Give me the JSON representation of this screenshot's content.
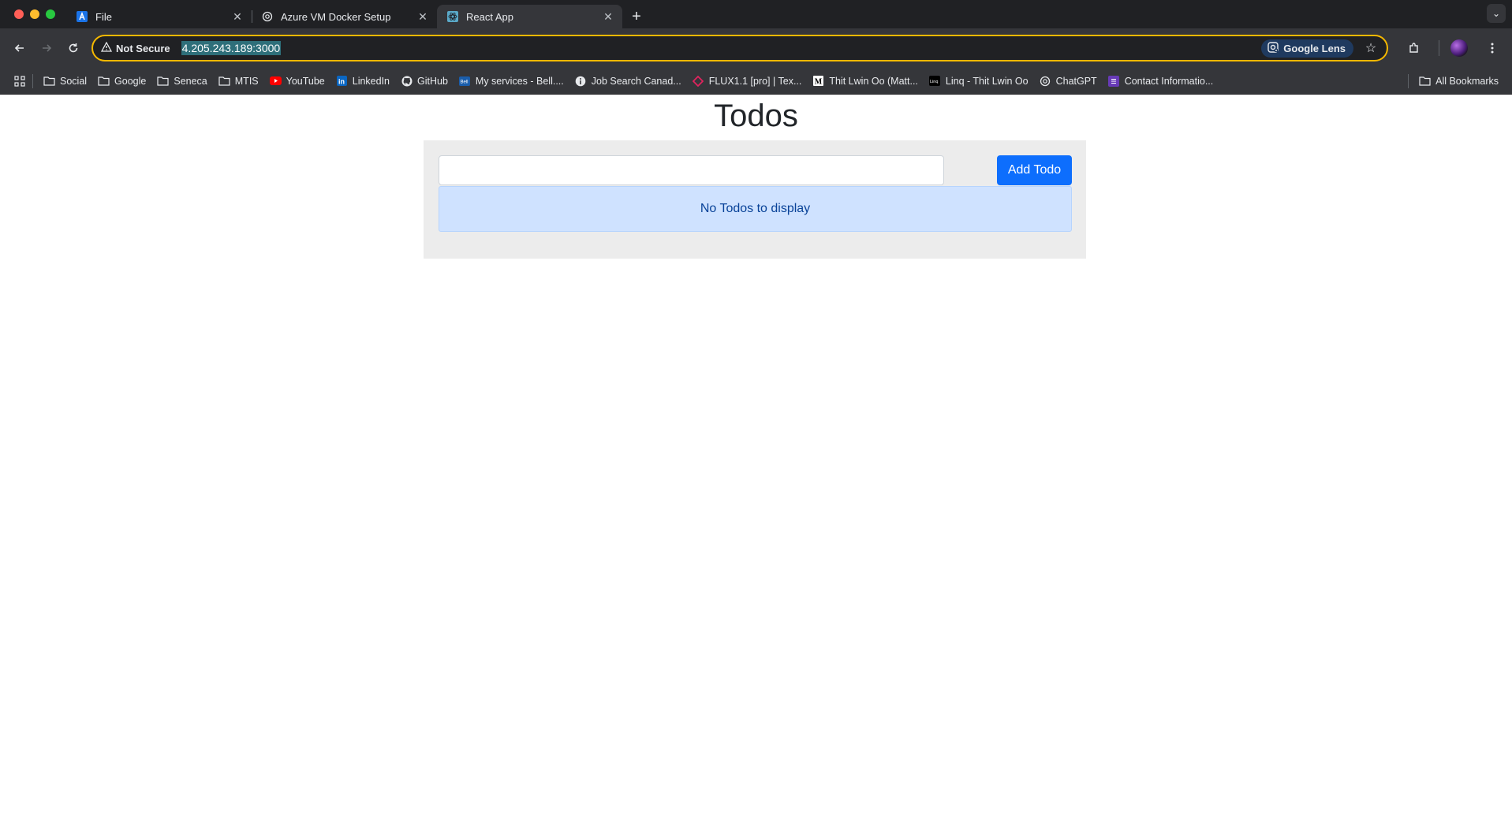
{
  "tabs": [
    {
      "title": "File",
      "icon": "azure-devops-icon",
      "active": false
    },
    {
      "title": "Azure VM Docker Setup",
      "icon": "chatgpt-icon",
      "active": false
    },
    {
      "title": "React App",
      "icon": "react-icon",
      "active": true
    }
  ],
  "toolbar": {
    "security_label": "Not Secure",
    "url": "4.205.243.189:3000",
    "lens_label": "Google Lens"
  },
  "bookmarks": {
    "items": [
      {
        "label": "Social",
        "icon": "folder-icon"
      },
      {
        "label": "Google",
        "icon": "folder-icon"
      },
      {
        "label": "Seneca",
        "icon": "folder-icon"
      },
      {
        "label": "MTIS",
        "icon": "folder-icon"
      },
      {
        "label": "YouTube",
        "icon": "youtube-icon"
      },
      {
        "label": "LinkedIn",
        "icon": "linkedin-icon"
      },
      {
        "label": "GitHub",
        "icon": "github-icon"
      },
      {
        "label": "My services - Bell....",
        "icon": "bell-icon"
      },
      {
        "label": "Job Search Canad...",
        "icon": "info-icon"
      },
      {
        "label": "FLUX1.1 [pro] | Tex...",
        "icon": "flux-icon"
      },
      {
        "label": "Thit Lwin Oo (Matt...",
        "icon": "medium-icon"
      },
      {
        "label": "Linq - Thit Lwin Oo",
        "icon": "linq-icon"
      },
      {
        "label": "ChatGPT",
        "icon": "chatgpt-icon"
      },
      {
        "label": "Contact Informatio...",
        "icon": "form-icon"
      }
    ],
    "all_bookmarks": "All Bookmarks"
  },
  "app": {
    "title": "Todos",
    "input_value": "",
    "add_button": "Add Todo",
    "empty_message": "No Todos to display"
  },
  "colors": {
    "primary": "#0d6efd",
    "alert_bg": "#cfe2ff",
    "alert_text": "#084298",
    "card_bg": "#ececec",
    "omnibox_focus": "#f5b800"
  }
}
